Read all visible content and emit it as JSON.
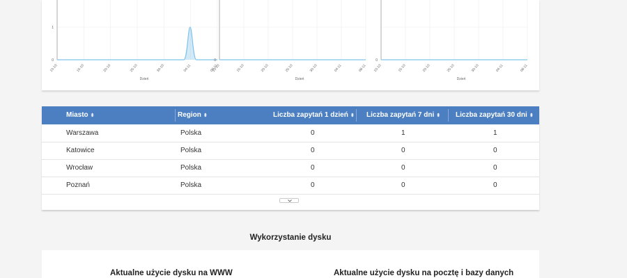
{
  "charts": {
    "x_ticks": [
      "10-10",
      "15-10",
      "20-10",
      "25-10",
      "30-10",
      "04-11",
      "08-11"
    ],
    "y_ticks_left": [
      "0",
      "1"
    ],
    "y_ticks_other": [
      "0"
    ],
    "x_axis_label": "Dzień",
    "line_color": "#7ec3ea",
    "chart_data": [
      {
        "type": "area",
        "x": [
          "10-10",
          "15-10",
          "20-10",
          "25-10",
          "30-10",
          "04-11",
          "08-11"
        ],
        "peak": {
          "x": "06-11",
          "y": 1
        },
        "ylim": [
          0,
          1
        ],
        "xlabel": "Dzień"
      },
      {
        "type": "area",
        "x": [
          "10-10",
          "15-10",
          "20-10",
          "25-10",
          "30-10",
          "04-11",
          "08-11"
        ],
        "values": [
          0,
          0,
          0,
          0,
          0,
          0,
          0
        ],
        "xlabel": "Dzień"
      },
      {
        "type": "area",
        "x": [
          "10-10",
          "15-10",
          "20-10",
          "25-10",
          "30-10",
          "04-11",
          "08-11"
        ],
        "values": [
          0,
          0,
          0,
          0,
          0,
          0,
          0
        ],
        "xlabel": "Dzień"
      }
    ]
  },
  "table": {
    "header_color": "#4b7fc1",
    "columns": [
      "Miasto",
      "Region",
      "Liczba zapytań 1 dzień",
      "Liczba zapytań 7 dni",
      "Liczba zapytań 30 dni"
    ],
    "sort_glyph": "⬍",
    "rows": [
      [
        "Warszawa",
        "Polska",
        "0",
        "1",
        "1"
      ],
      [
        "Katowice",
        "Polska",
        "0",
        "0",
        "0"
      ],
      [
        "Wrocław",
        "Polska",
        "0",
        "0",
        "0"
      ],
      [
        "Poznań",
        "Polska",
        "0",
        "0",
        "0"
      ]
    ]
  },
  "disk": {
    "section_title": "Wykorzystanie dysku",
    "www_title": "Aktualne użycie dysku na WWW",
    "mail_title": "Aktualne użycie dysku na pocztę i bazy danych"
  }
}
